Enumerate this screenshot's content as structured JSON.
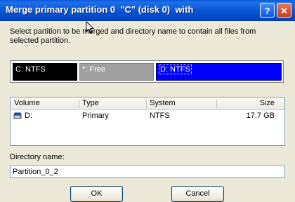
{
  "window": {
    "title": "Merge primary partition 0  \"C\" (disk 0)  with",
    "help_glyph": "?",
    "close_glyph": "✕"
  },
  "instruction": "Select partition to be merged and directory name to contain all files from selected partition.",
  "partitions": [
    {
      "label": "C: NTFS",
      "color": "#000000"
    },
    {
      "label": "*: Free",
      "color": "#a0a0a0"
    },
    {
      "label": "D: NTFS",
      "color": "#0000ff"
    }
  ],
  "list": {
    "headers": {
      "volume": "Volume",
      "type": "Type",
      "system": "System",
      "size": "Size"
    },
    "rows": [
      {
        "volume": "D:",
        "type": "Primary",
        "system": "NTFS",
        "size": "17.7 GB",
        "icon": "drive-icon"
      }
    ]
  },
  "directory": {
    "label": "Directory name:",
    "value": "Partition_0_2"
  },
  "buttons": {
    "ok": "OK",
    "cancel": "Cancel"
  }
}
